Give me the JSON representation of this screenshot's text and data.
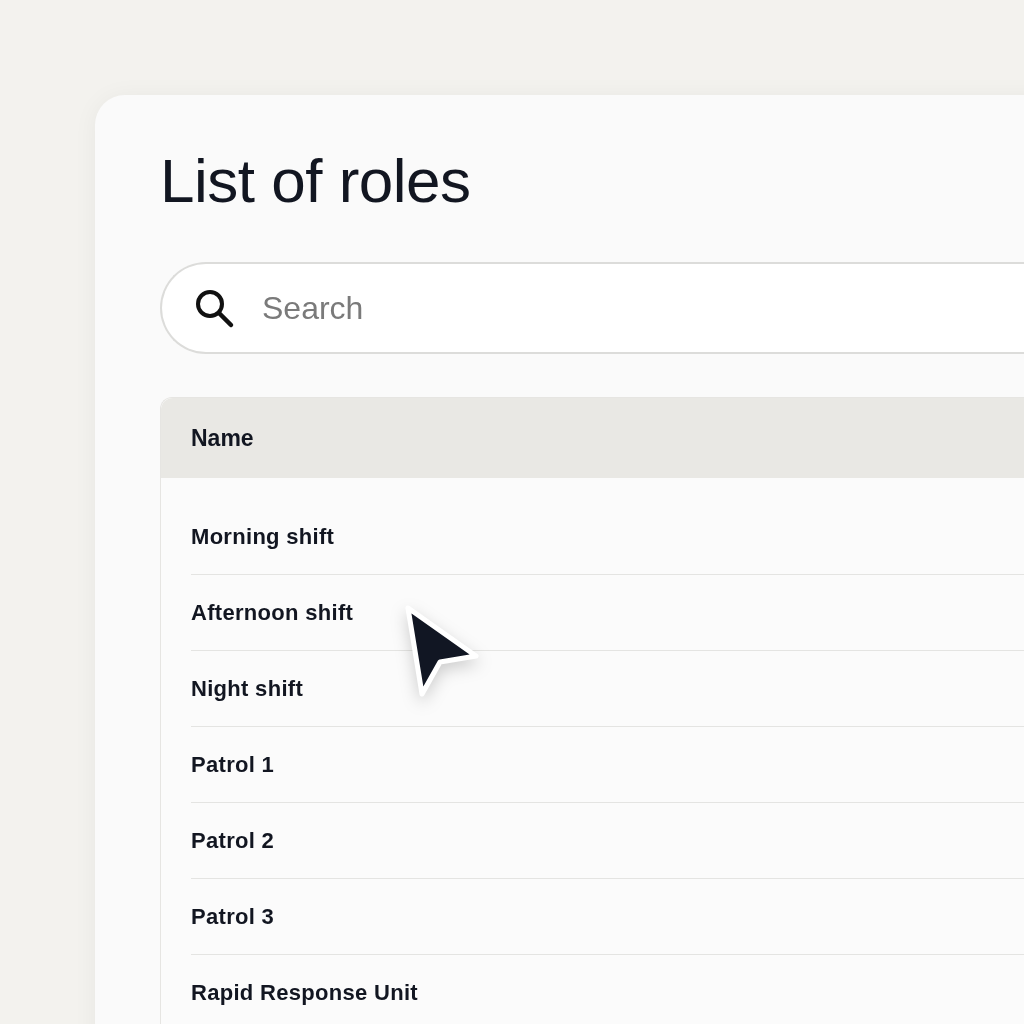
{
  "title": "List of roles",
  "search": {
    "placeholder": "Search"
  },
  "table": {
    "columns": [
      "Name"
    ],
    "rows": [
      {
        "name": "Morning shift"
      },
      {
        "name": "Afternoon shift"
      },
      {
        "name": "Night shift"
      },
      {
        "name": "Patrol 1"
      },
      {
        "name": "Patrol 2"
      },
      {
        "name": "Patrol 3"
      },
      {
        "name": "Rapid Response Unit"
      }
    ]
  }
}
